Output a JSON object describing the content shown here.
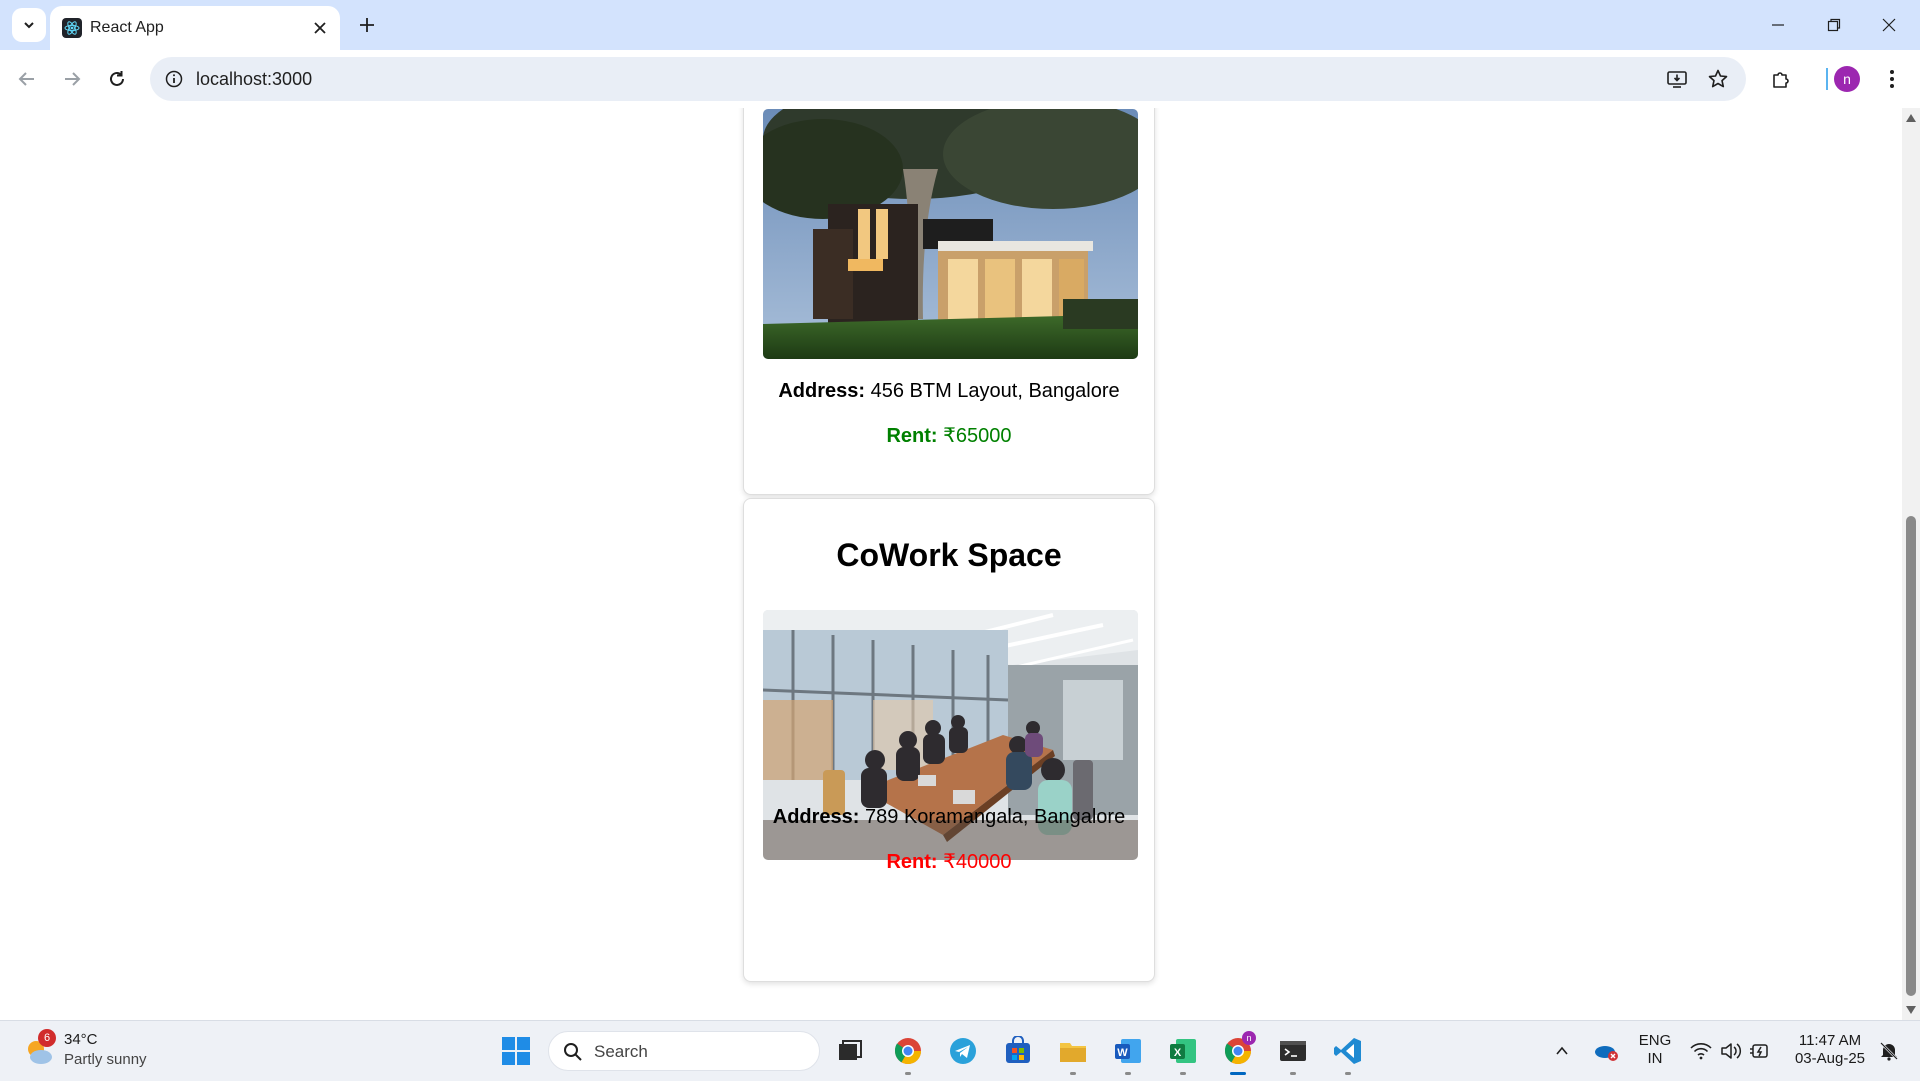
{
  "browser": {
    "tab_title": "React App",
    "url": "localhost:3000",
    "avatar_letter": "n"
  },
  "listings": [
    {
      "title": "",
      "address_label": "Address:",
      "address": "456 BTM Layout, Bangalore",
      "rent_label": "Rent:",
      "rent": "₹65000",
      "rent_color": "#008000"
    },
    {
      "title": "CoWork Space",
      "address_label": "Address:",
      "address": "789 Koramangala, Bangalore",
      "rent_label": "Rent:",
      "rent": "₹40000",
      "rent_color": "#ff0000"
    }
  ],
  "taskbar": {
    "weather_temp": "34°C",
    "weather_condition": "Partly sunny",
    "weather_badge": "6",
    "search_label": "Search",
    "lang_top": "ENG",
    "lang_bottom": "IN",
    "time": "11:47 AM",
    "date": "03-Aug-25",
    "chrome_badge": "n"
  }
}
